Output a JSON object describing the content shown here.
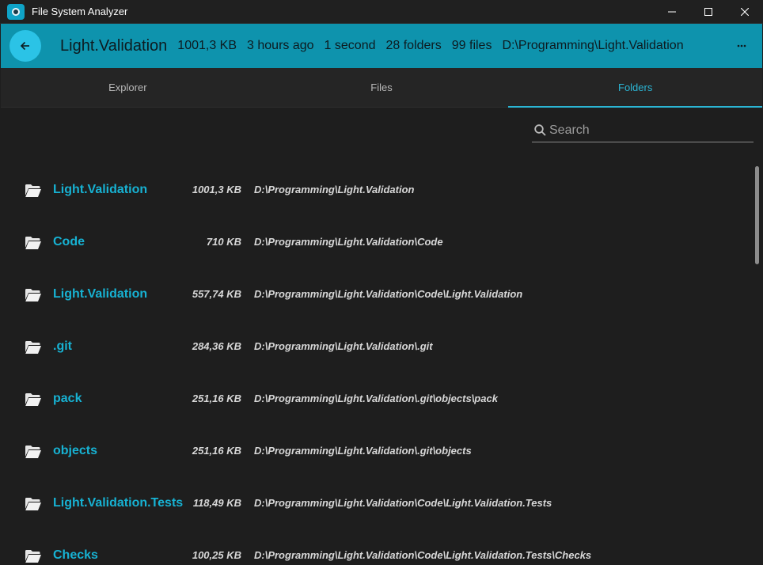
{
  "window": {
    "title": "File System Analyzer",
    "controls": [
      "minimize-icon",
      "maximize-icon",
      "close-icon"
    ]
  },
  "header": {
    "title": "Light.Validation",
    "size": "1001,3 KB",
    "modified": "3 hours ago",
    "duration": "1 second",
    "folders": "28 folders",
    "files": "99 files",
    "path": "D:\\Programming\\Light.Validation",
    "accent_color": "#0e93ad"
  },
  "tabs": [
    {
      "label": "Explorer",
      "active": false
    },
    {
      "label": "Files",
      "active": false
    },
    {
      "label": "Folders",
      "active": true
    }
  ],
  "search": {
    "placeholder": "Search",
    "value": ""
  },
  "folders": [
    {
      "name": "Light.Validation",
      "size": "1001,3 KB",
      "path": "D:\\Programming\\Light.Validation"
    },
    {
      "name": "Code",
      "size": "710 KB",
      "path": "D:\\Programming\\Light.Validation\\Code"
    },
    {
      "name": "Light.Validation",
      "size": "557,74 KB",
      "path": "D:\\Programming\\Light.Validation\\Code\\Light.Validation"
    },
    {
      "name": ".git",
      "size": "284,36 KB",
      "path": "D:\\Programming\\Light.Validation\\.git"
    },
    {
      "name": "pack",
      "size": "251,16 KB",
      "path": "D:\\Programming\\Light.Validation\\.git\\objects\\pack"
    },
    {
      "name": "objects",
      "size": "251,16 KB",
      "path": "D:\\Programming\\Light.Validation\\.git\\objects"
    },
    {
      "name": "Light.Validation.Tests",
      "size": "118,49 KB",
      "path": "D:\\Programming\\Light.Validation\\Code\\Light.Validation.Tests"
    },
    {
      "name": "Checks",
      "size": "100,25 KB",
      "path": "D:\\Programming\\Light.Validation\\Code\\Light.Validation.Tests\\Checks"
    }
  ]
}
